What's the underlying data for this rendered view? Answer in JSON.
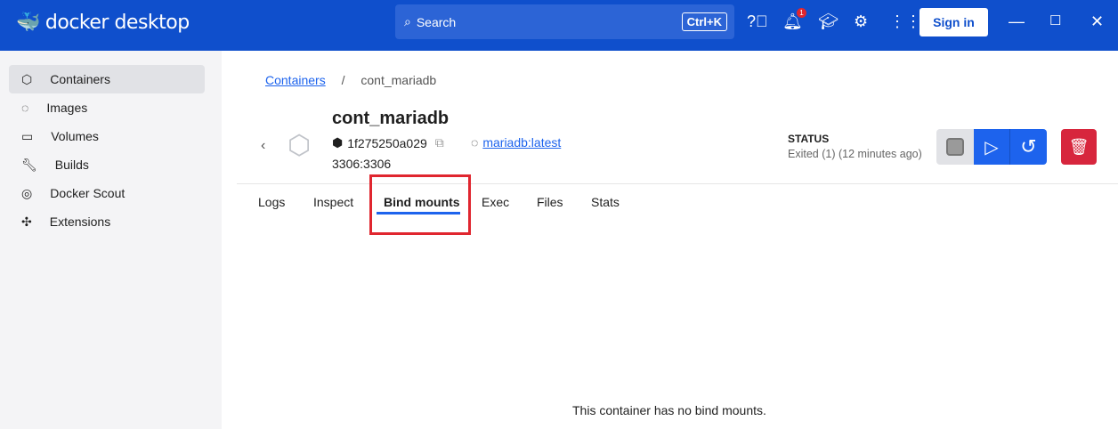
{
  "app": {
    "logo_text": "docker desktop",
    "search_placeholder": "Search",
    "search_shortcut": "Ctrl+K",
    "notification_count": "1",
    "sign_in": "Sign in"
  },
  "sidebar": {
    "items": [
      {
        "label": "Containers",
        "active": true
      },
      {
        "label": "Images"
      },
      {
        "label": "Volumes"
      },
      {
        "label": "Builds"
      },
      {
        "label": "Docker Scout"
      },
      {
        "label": "Extensions"
      }
    ]
  },
  "breadcrumb": {
    "parent": "Containers",
    "separator": "/",
    "current": "cont_mariadb"
  },
  "container": {
    "name": "cont_mariadb",
    "id": "1f275250a029",
    "image": "mariadb:latest",
    "ports": "3306:3306",
    "status_label": "STATUS",
    "status_value": "Exited (1) (12 minutes ago)"
  },
  "tabs": [
    {
      "label": "Logs"
    },
    {
      "label": "Inspect"
    },
    {
      "label": "Bind mounts",
      "active": true
    },
    {
      "label": "Exec"
    },
    {
      "label": "Files"
    },
    {
      "label": "Stats"
    }
  ],
  "content": {
    "empty_message": "This container has no bind mounts."
  },
  "colors": {
    "header": "#0f4fcc",
    "accent": "#1d63ed",
    "danger": "#d7263d"
  }
}
